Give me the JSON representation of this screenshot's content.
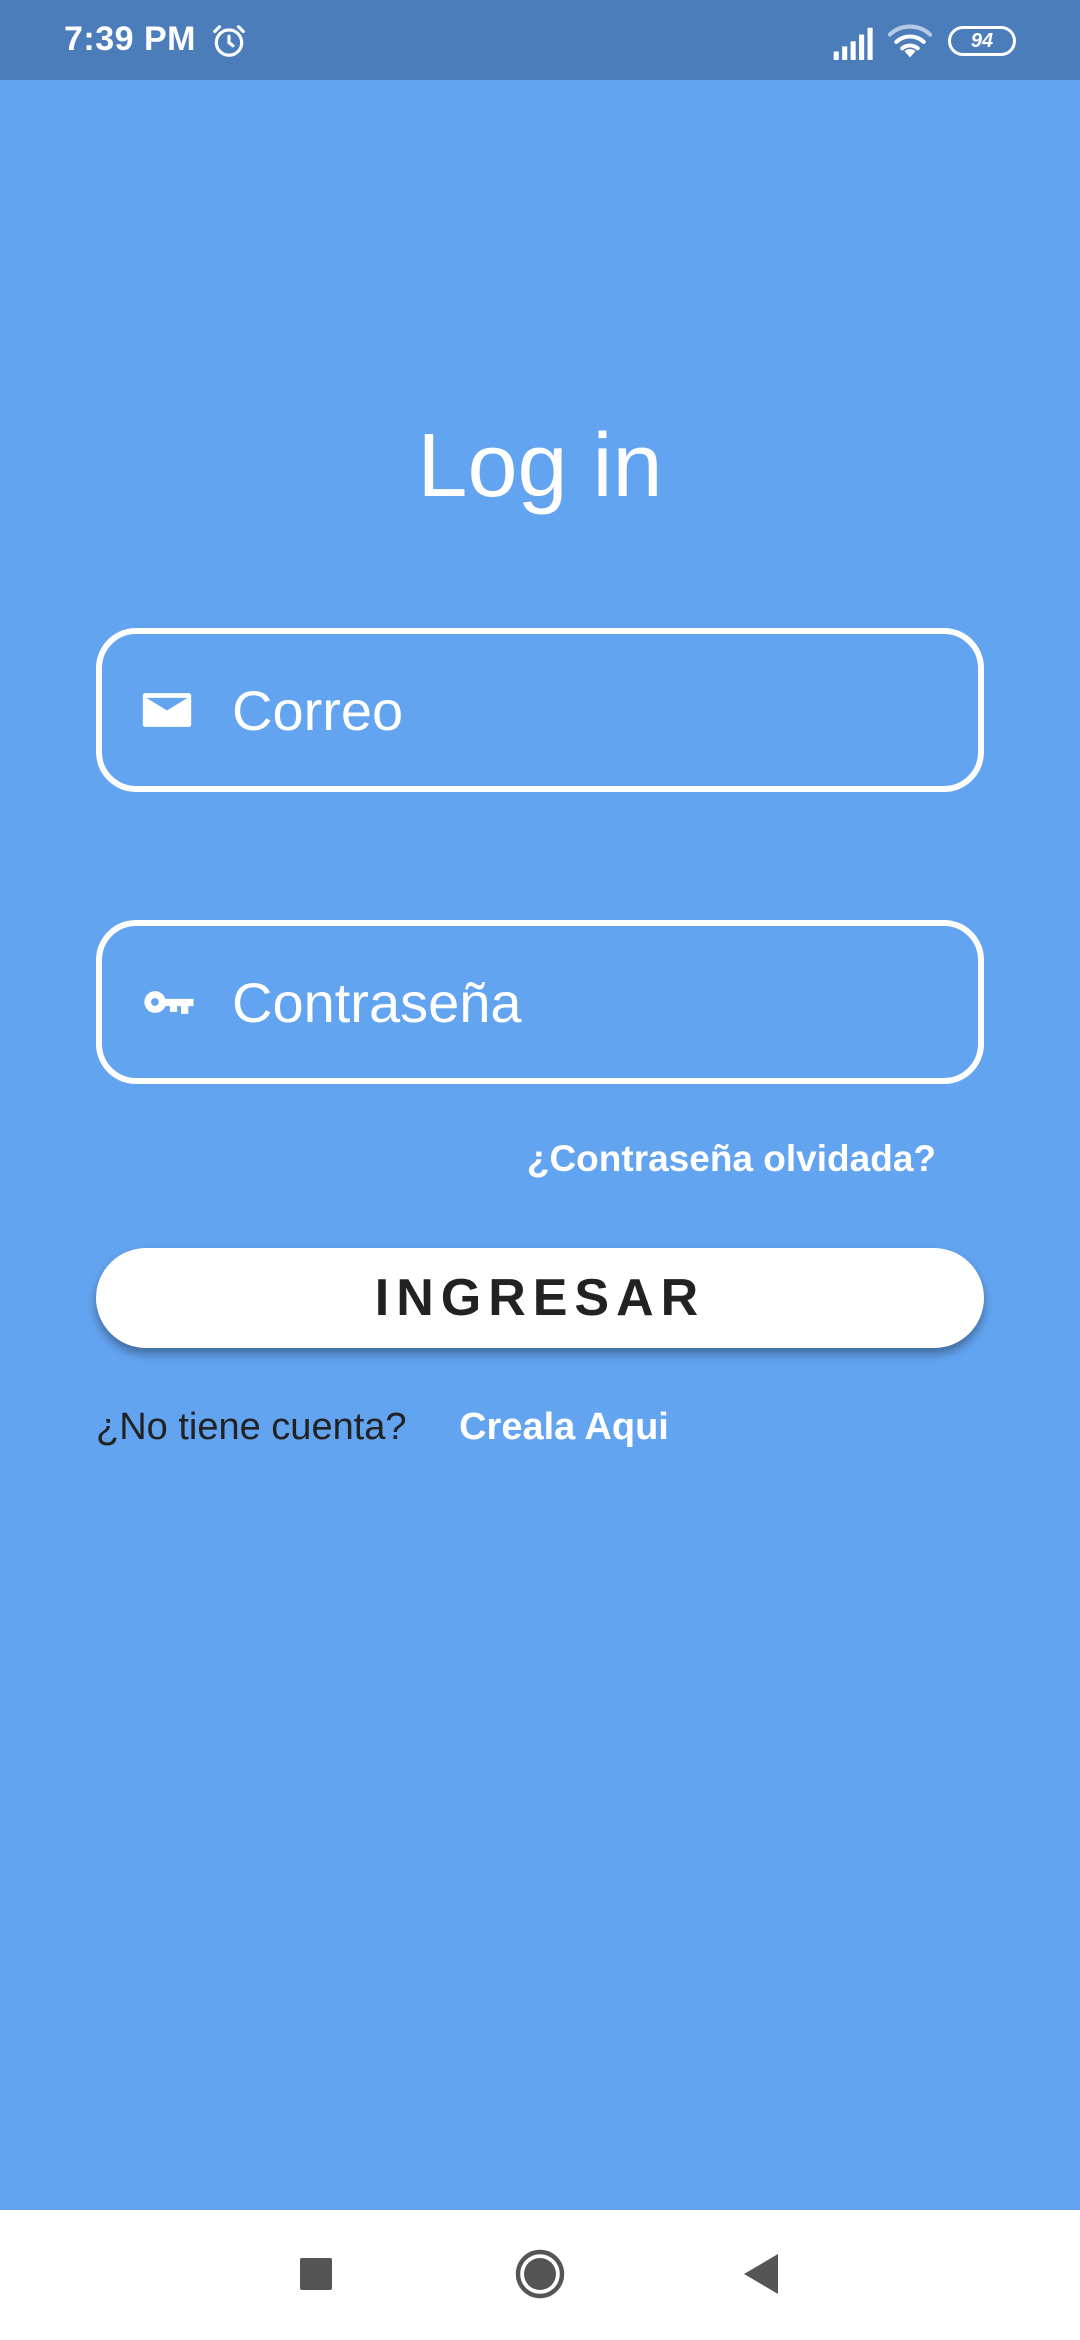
{
  "status_bar": {
    "time": "7:39 PM",
    "battery": "94",
    "icons": [
      "alarm-icon",
      "signal-icon",
      "wifi-icon",
      "battery-icon"
    ]
  },
  "login": {
    "title": "Log in",
    "email_placeholder": "Correo",
    "password_placeholder": "Contraseña",
    "forgot_password": "¿Contraseña olvidada?",
    "submit_label": "INGRESAR",
    "no_account_prompt": "¿No tiene cuenta?",
    "create_account_link": "Creala Aqui"
  },
  "nav_bar": {
    "icons": [
      "recents-icon",
      "home-icon",
      "back-icon"
    ]
  },
  "colors": {
    "background": "#63A4F1",
    "status_bar": "#4A7DBA",
    "field_border": "#FFFFFF",
    "button_bg": "#FFFFFF",
    "button_text": "#222222"
  }
}
